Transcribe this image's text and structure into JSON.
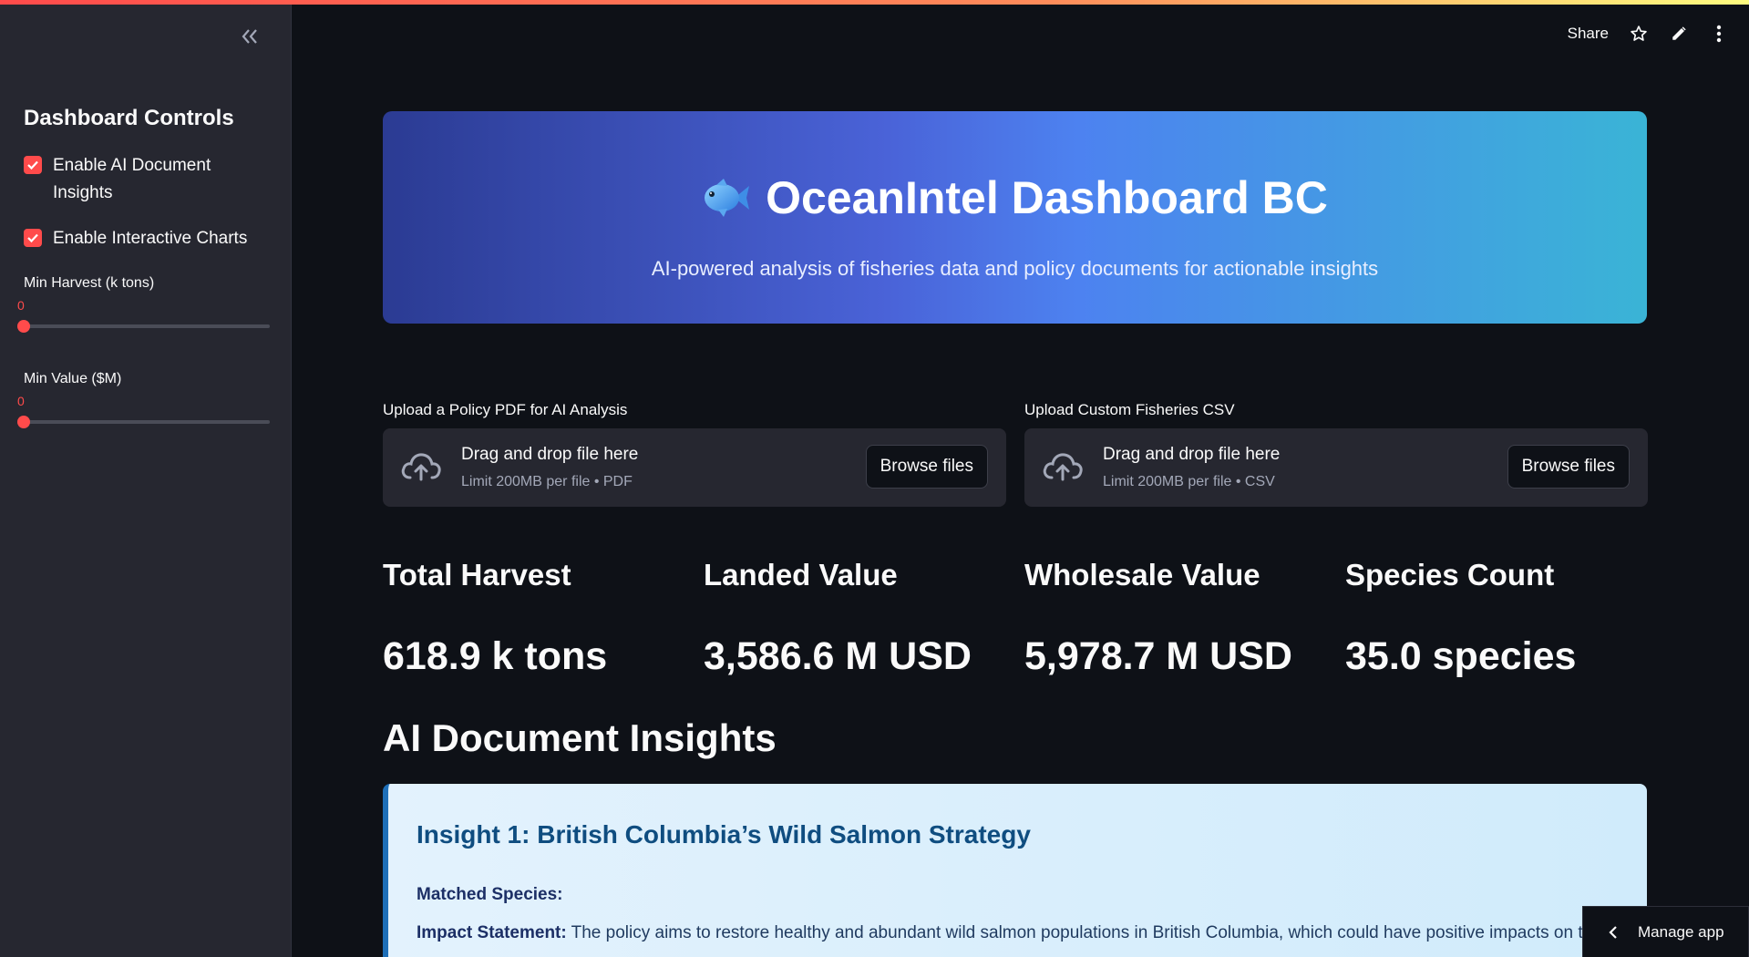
{
  "sidebar": {
    "title": "Dashboard Controls",
    "checkboxes": [
      {
        "label_line1": "Enable AI Document",
        "label_line2": "Insights",
        "checked": true
      },
      {
        "label": "Enable Interactive Charts",
        "checked": true
      }
    ],
    "sliders": [
      {
        "label": "Min Harvest (k tons)",
        "value": "0"
      },
      {
        "label": "Min Value ($M)",
        "value": "0"
      }
    ]
  },
  "header": {
    "share_label": "Share"
  },
  "hero": {
    "title": "OceanIntel Dashboard BC",
    "subtitle": "AI-powered analysis of fisheries data and policy documents for actionable insights"
  },
  "uploaders": [
    {
      "label": "Upload a Policy PDF for AI Analysis",
      "drop_text": "Drag and drop file here",
      "limit": "Limit 200MB per file • PDF",
      "button": "Browse files"
    },
    {
      "label": "Upload Custom Fisheries CSV",
      "drop_text": "Drag and drop file here",
      "limit": "Limit 200MB per file • CSV",
      "button": "Browse files"
    }
  ],
  "metrics": [
    {
      "label": "Total Harvest",
      "value": "618.9 k tons"
    },
    {
      "label": "Landed Value",
      "value": "3,586.6 M USD"
    },
    {
      "label": "Wholesale Value",
      "value": "5,978.7 M USD"
    },
    {
      "label": "Species Count",
      "value": "35.0 species"
    }
  ],
  "insights": {
    "heading": "AI Document Insights",
    "card": {
      "title": "Insight 1: British Columbia’s Wild Salmon Strategy",
      "matched_label": "Matched Species:",
      "impact_label": "Impact Statement:",
      "impact_text": " The policy aims to restore healthy and abundant wild salmon populations in British Columbia, which could have positive impacts on the"
    }
  },
  "manage_app": {
    "label": "Manage app"
  },
  "colors": {
    "accent": "#ff4b4b",
    "background": "#0e1117",
    "sidebar": "#262730"
  }
}
